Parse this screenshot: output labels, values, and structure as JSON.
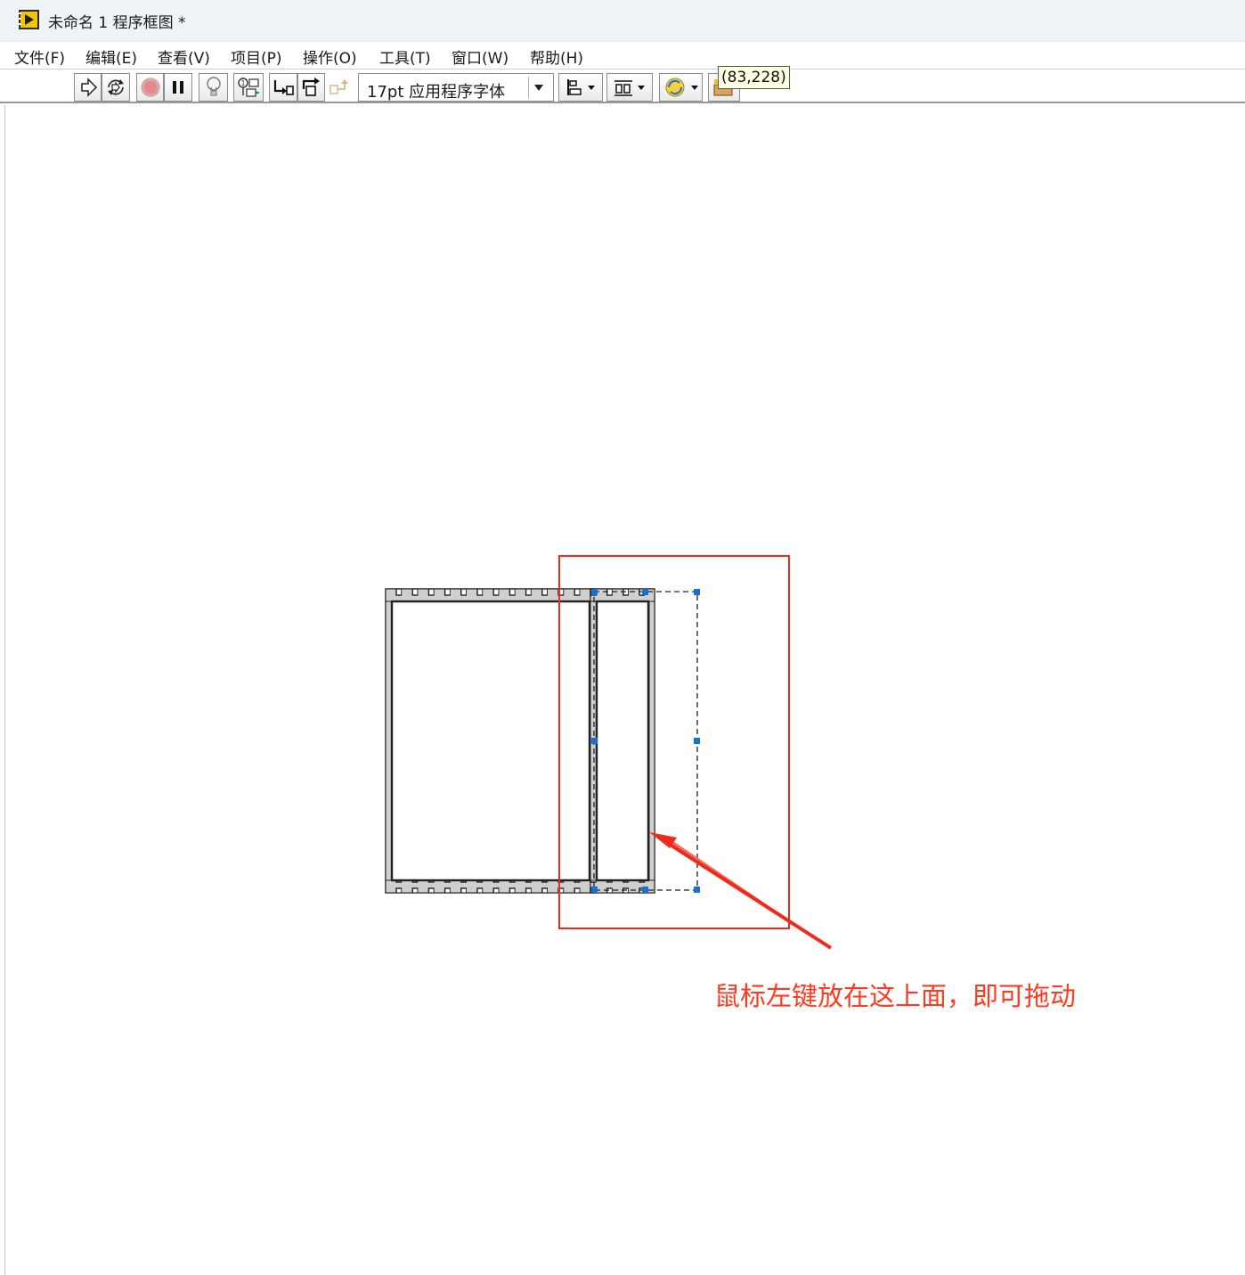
{
  "window": {
    "title": "未命名 1 程序框图 *"
  },
  "menu": {
    "items": [
      {
        "label": "文件(F)"
      },
      {
        "label": "编辑(E)"
      },
      {
        "label": "查看(V)"
      },
      {
        "label": "项目(P)"
      },
      {
        "label": "操作(O)"
      },
      {
        "label": "工具(T)"
      },
      {
        "label": "窗口(W)"
      },
      {
        "label": "帮助(H)"
      }
    ]
  },
  "toolbar": {
    "run_icon": "run-arrow-icon",
    "run_continuously_icon": "run-continuously-icon",
    "abort_icon": "abort-stop-icon",
    "pause_icon": "pause-icon",
    "highlight_icon": "lightbulb-icon",
    "retain_wire_values_icon": "retain-wire-values-icon",
    "step_into_icon": "step-into-icon",
    "step_over_icon": "step-over-icon",
    "step_out_icon": "step-out-icon",
    "font_select_value": "17pt 应用程序字体",
    "align_icon": "align-objects-icon",
    "distribute_icon": "distribute-objects-icon",
    "reorder_icon": "reorder-icon",
    "cleanup_icon": "cleanup-diagram-icon"
  },
  "tooltip": {
    "text": "(83,228)"
  },
  "diagram": {
    "structure": "flat-sequence",
    "frames_shown": 2,
    "annotation_text": "鼠标左键放在这上面，即可拖动",
    "annotation_color": "#ff3a1e"
  }
}
